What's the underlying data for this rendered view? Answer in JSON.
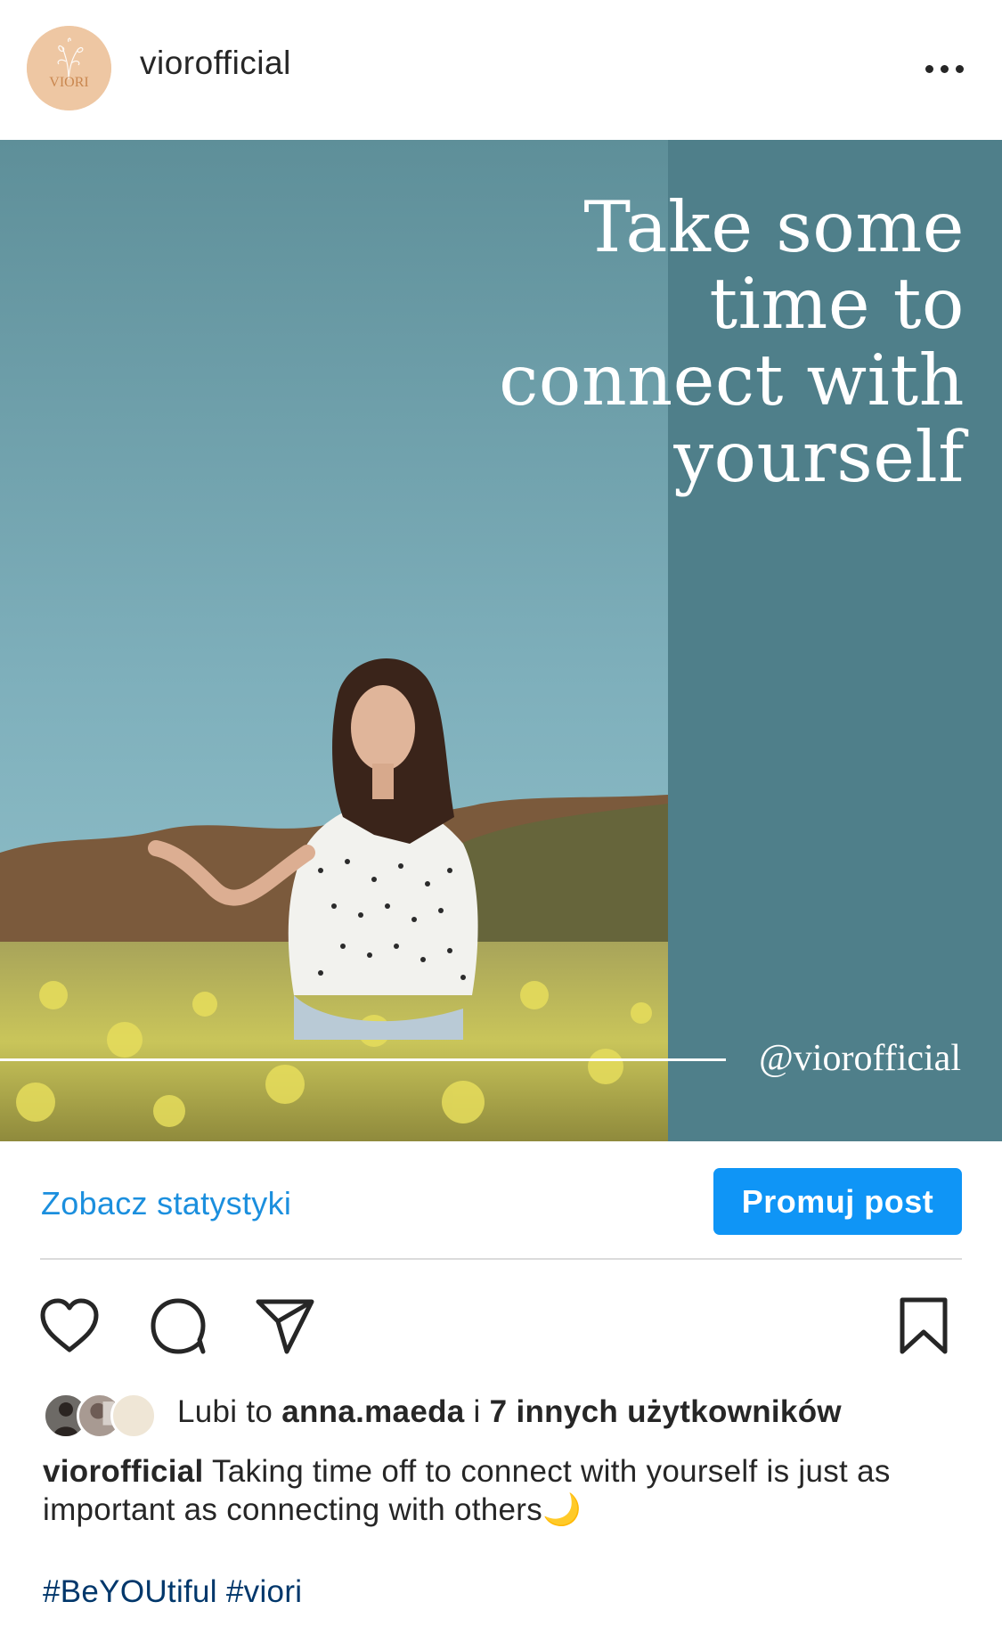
{
  "header": {
    "username": "viorofficial",
    "avatar_text": "VIORI",
    "more_icon": "more-horizontal-icon"
  },
  "post": {
    "quote": "Take some time to connect with yourself",
    "quote_lines": [
      "Take some",
      "time to",
      "connect with",
      "yourself"
    ],
    "handle": "@viorofficial",
    "colors": {
      "panel": "#4f7f8a",
      "sky_top": "#5e8f99",
      "sky_bottom": "#8ab9c4",
      "field": "#c9c55a"
    }
  },
  "actions": {
    "stats_link": "Zobacz statystyki",
    "promote_button": "Promuj post",
    "icons": [
      "heart-icon",
      "comment-icon",
      "share-icon",
      "bookmark-icon"
    ]
  },
  "likes": {
    "prefix": "Lubi to ",
    "first_user": "anna.maeda",
    "middle": " i ",
    "others": "7 innych użytkowników"
  },
  "caption": {
    "username": "viorofficial",
    "text": " Taking time off to connect with yourself is just as important as connecting with others🌙",
    "hashtags": "#BeYOUtiful #viori"
  },
  "accent_colors": {
    "link": "#1b8fde",
    "button": "#0f95f6",
    "hashtag": "#00376b"
  }
}
